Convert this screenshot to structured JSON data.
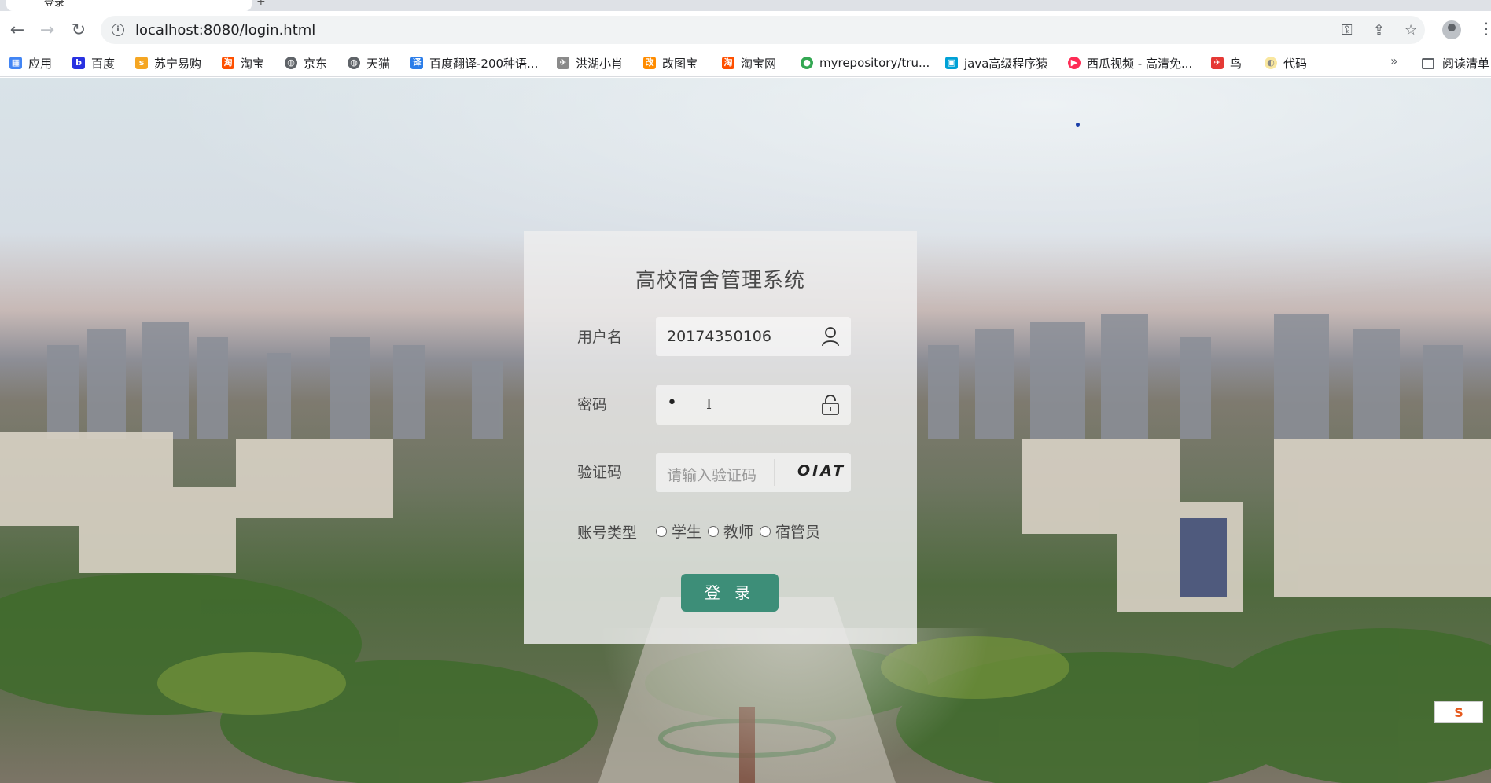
{
  "browser": {
    "tab_title": "登录",
    "new_tab_symbol": "+",
    "url": "localhost:8080/login.html",
    "back_symbol": "←",
    "forward_symbol": "→",
    "reload_symbol": "↻",
    "icons": [
      "key-icon",
      "share-icon",
      "star-icon",
      "profile-icon",
      "menu-icon"
    ]
  },
  "bookmarks": {
    "items": [
      {
        "label": "应用",
        "icon": "apps-icon",
        "color": "#4285f4"
      },
      {
        "label": "百度",
        "icon": "baidu-icon",
        "color": "#2932e1"
      },
      {
        "label": "苏宁易购",
        "icon": "suning-icon",
        "color": "#f5a623"
      },
      {
        "label": "淘宝",
        "icon": "taobao-icon",
        "color": "#ff5000"
      },
      {
        "label": "京东",
        "icon": "globe-icon",
        "color": "#5f6368"
      },
      {
        "label": "天猫",
        "icon": "globe-icon",
        "color": "#5f6368"
      },
      {
        "label": "百度翻译-200种语...",
        "icon": "translate-icon",
        "color": "#2b7de9"
      },
      {
        "label": "洪湖小肖",
        "icon": "bird-icon",
        "color": "#8a8a8a"
      },
      {
        "label": "改图宝",
        "icon": "gaitubao-icon",
        "color": "#ff8c00"
      },
      {
        "label": "淘宝网",
        "icon": "taobao-icon",
        "color": "#ff5000"
      },
      {
        "label": "myrepository/tru...",
        "icon": "chrome-icon",
        "color": "#34a853"
      },
      {
        "label": "java高级程序猿",
        "icon": "bilibili-icon",
        "color": "#00a1d6"
      },
      {
        "label": "西瓜视频 - 高清免...",
        "icon": "xigua-icon",
        "color": "#fe2c55"
      },
      {
        "label": "鸟",
        "icon": "bird-icon",
        "color": "#e53935"
      },
      {
        "label": "代码",
        "icon": "code-icon",
        "color": "#f9e79f"
      }
    ],
    "more_symbol": "»",
    "reading_list_label": "阅读清单"
  },
  "login": {
    "title": "高校宿舍管理系统",
    "username_label": "用户名",
    "username_value": "20174350106",
    "password_label": "密码",
    "password_value": "•",
    "captcha_label": "验证码",
    "captcha_placeholder": "请输入验证码",
    "captcha_code": "OIAT",
    "account_type_label": "账号类型",
    "account_types": [
      "学生",
      "教师",
      "宿管员"
    ],
    "submit_label": "登 录"
  },
  "ime_badge": "S"
}
